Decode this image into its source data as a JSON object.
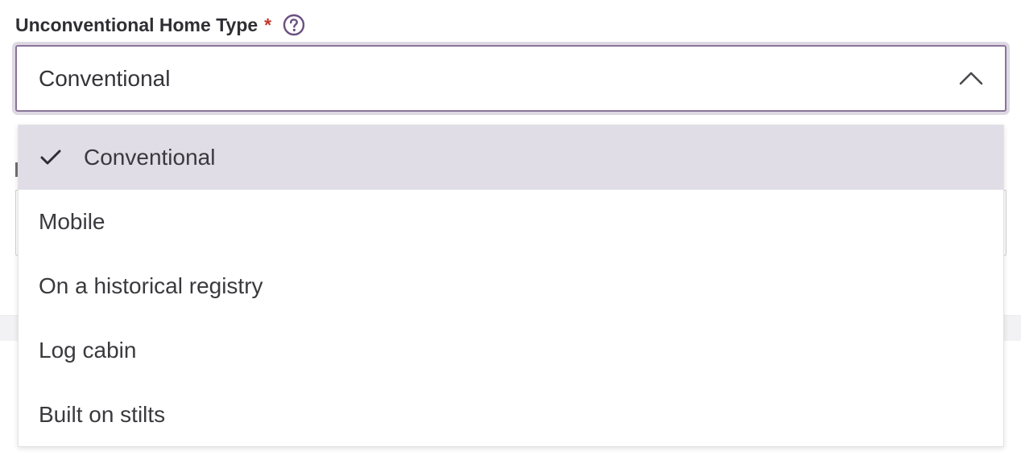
{
  "field": {
    "label": "Unconventional Home Type",
    "required_mark": "*",
    "help_icon": "question-circle-icon",
    "selected_value": "Conventional",
    "toggle_icon": "chevron-up-icon"
  },
  "dropdown": {
    "check_icon": "checkmark-icon",
    "options": [
      {
        "label": "Conventional",
        "selected": true
      },
      {
        "label": "Mobile",
        "selected": false
      },
      {
        "label": "On a historical registry",
        "selected": false
      },
      {
        "label": "Log cabin",
        "selected": false
      },
      {
        "label": "Built on stilts",
        "selected": false
      }
    ]
  },
  "colors": {
    "focus_border": "#8a7499",
    "selected_bg": "#e0dde6",
    "required": "#c0392b",
    "help_icon": "#6b4f80"
  }
}
